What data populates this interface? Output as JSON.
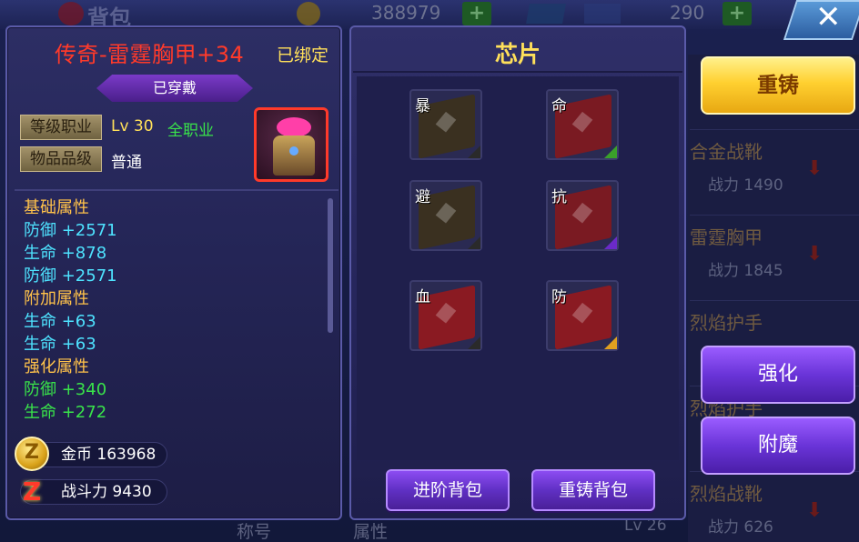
{
  "background": {
    "bag_label": "背包",
    "gold_amount": "388979",
    "diamond_amount": "290",
    "plus": "+",
    "close_glyph": "✕",
    "list_rows": [
      {
        "name": "合金战靴",
        "power": "战力 1490"
      },
      {
        "name": "雷霆胸甲",
        "power": "战力 1845"
      },
      {
        "name": "烈焰护手",
        "power": ""
      },
      {
        "name": "烈焰护手",
        "power": ""
      },
      {
        "name": "烈焰战靴",
        "power": "战力 626"
      }
    ],
    "lv_text": "Lv 26",
    "bottom_tabs": [
      "称号",
      "属性"
    ]
  },
  "item": {
    "name": "传奇-雷霆胸甲+34",
    "bound": "已绑定",
    "worn_tag": "已穿戴",
    "level_key": "等级职业",
    "level_value": "Lv 30",
    "class_value": "全职业",
    "quality_key": "物品品级",
    "quality_value": "普通"
  },
  "stats": [
    {
      "text": "基础属性",
      "style": "head"
    },
    {
      "text": "防御 +2571",
      "style": "cyan"
    },
    {
      "text": "生命 +878",
      "style": "cyan"
    },
    {
      "text": "防御 +2571",
      "style": "cyan"
    },
    {
      "text": "附加属性",
      "style": "head"
    },
    {
      "text": "生命 +63",
      "style": "cyan"
    },
    {
      "text": "生命 +63",
      "style": "cyan"
    },
    {
      "text": "强化属性",
      "style": "head"
    },
    {
      "text": "防御 +340",
      "style": "green"
    },
    {
      "text": "生命 +272",
      "style": "green"
    }
  ],
  "currency": {
    "gold_label": "金币 163968",
    "power_label": "战斗力 9430",
    "gold_glyph": "Z",
    "power_glyph": "Z"
  },
  "chips": {
    "title": "芯片",
    "slots": [
      {
        "label": "暴",
        "color": "#3a3020",
        "corner": "#2a2a2a"
      },
      {
        "label": "命",
        "color": "#7a1a22",
        "corner": "#3aa02a"
      },
      {
        "label": "避",
        "color": "#3a3020",
        "corner": "#2a2a2a"
      },
      {
        "label": "抗",
        "color": "#7a1a22",
        "corner": "#6a2ac8"
      },
      {
        "label": "血",
        "color": "#8a1a22",
        "corner": "#2a2a2a"
      },
      {
        "label": "防",
        "color": "#8a1a22",
        "corner": "#e0a020"
      }
    ],
    "advance_bag": "进阶背包",
    "reforge_bag": "重铸背包"
  },
  "actions": {
    "reforge": "重铸",
    "enhance": "强化",
    "enchant": "附魔"
  }
}
